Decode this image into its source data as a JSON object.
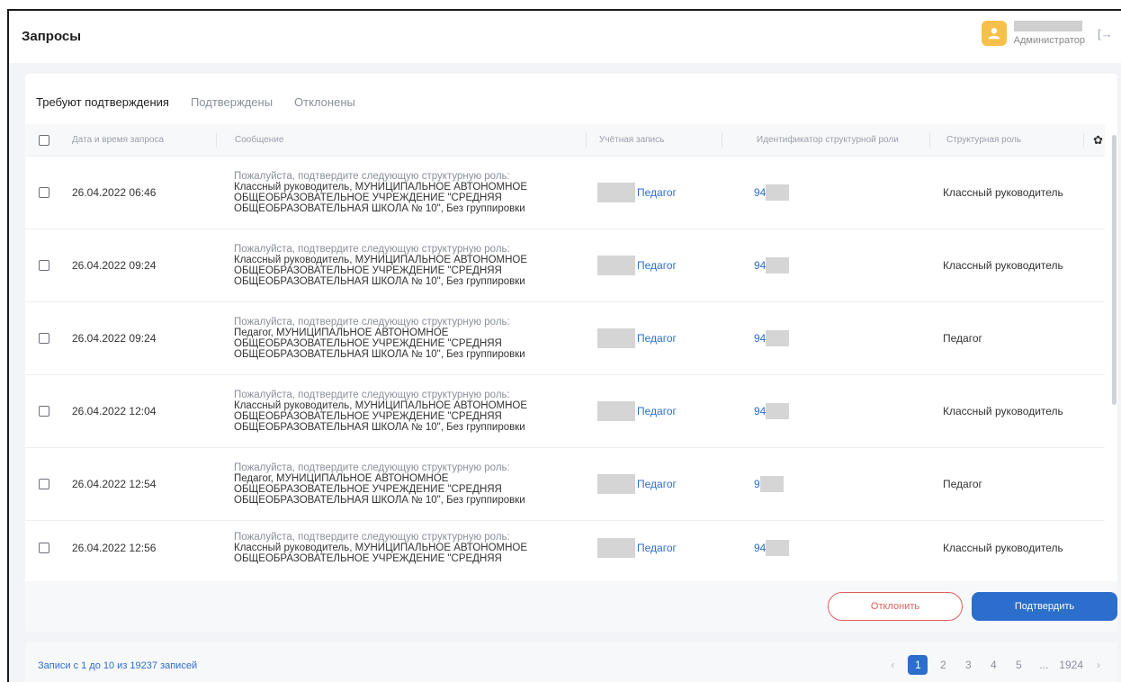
{
  "header": {
    "title": "Запросы",
    "user_role": "Администратор"
  },
  "tabs": [
    {
      "label": "Требуют подтверждения",
      "active": true
    },
    {
      "label": "Подтверждены",
      "active": false
    },
    {
      "label": "Отклонены",
      "active": false
    }
  ],
  "table": {
    "columns": {
      "date": "Дата и время запроса",
      "message": "Сообщение",
      "account": "Учётная запись",
      "role_id": "Идентификатор структурной роли",
      "role": "Структурная роль"
    },
    "rows": [
      {
        "date": "26.04.2022 06:46",
        "msg_top": "Пожалуйста, подтвердите следующую структурную роль:",
        "msg_body": "Классный руководитель, МУНИЦИПАЛЬНОЕ АВТОНОМНОЕ ОБЩЕОБРАЗОВАТЕЛЬНОЕ УЧРЕЖДЕНИЕ \"СРЕДНЯЯ ОБЩЕОБРАЗОВАТЕЛЬНАЯ ШКОЛА № 10\", Без группировки",
        "account": "Педагог",
        "role_id": "94",
        "role": "Классный руководитель"
      },
      {
        "date": "26.04.2022 09:24",
        "msg_top": "Пожалуйста, подтвердите следующую структурную роль:",
        "msg_body": "Классный руководитель, МУНИЦИПАЛЬНОЕ АВТОНОМНОЕ ОБЩЕОБРАЗОВАТЕЛЬНОЕ УЧРЕЖДЕНИЕ \"СРЕДНЯЯ ОБЩЕОБРАЗОВАТЕЛЬНАЯ ШКОЛА № 10\", Без группировки",
        "account": "Педагог",
        "role_id": "94",
        "role": "Классный руководитель"
      },
      {
        "date": "26.04.2022 09:24",
        "msg_top": "Пожалуйста, подтвердите следующую структурную роль:",
        "msg_body": "Педагог, МУНИЦИПАЛЬНОЕ АВТОНОМНОЕ ОБЩЕОБРАЗОВАТЕЛЬНОЕ УЧРЕЖДЕНИЕ \"СРЕДНЯЯ ОБЩЕОБРАЗОВАТЕЛЬНАЯ ШКОЛА № 10\", Без группировки",
        "account": "Педагог",
        "role_id": "94",
        "role": "Педагог"
      },
      {
        "date": "26.04.2022 12:04",
        "msg_top": "Пожалуйста, подтвердите следующую структурную роль:",
        "msg_body": "Классный руководитель, МУНИЦИПАЛЬНОЕ АВТОНОМНОЕ ОБЩЕОБРАЗОВАТЕЛЬНОЕ УЧРЕЖДЕНИЕ \"СРЕДНЯЯ ОБЩЕОБРАЗОВАТЕЛЬНАЯ ШКОЛА № 10\", Без группировки",
        "account": "Педагог",
        "role_id": "94",
        "role": "Классный руководитель"
      },
      {
        "date": "26.04.2022 12:54",
        "msg_top": "Пожалуйста, подтвердите следующую структурную роль:",
        "msg_body": "Педагог, МУНИЦИПАЛЬНОЕ АВТОНОМНОЕ ОБЩЕОБРАЗОВАТЕЛЬНОЕ УЧРЕЖДЕНИЕ \"СРЕДНЯЯ ОБЩЕОБРАЗОВАТЕЛЬНАЯ ШКОЛА № 10\", Без группировки",
        "account": "Педагог",
        "role_id": "9",
        "role": "Педагог"
      },
      {
        "date": "26.04.2022 12:56",
        "msg_top": "Пожалуйста, подтвердите следующую структурную роль:",
        "msg_body": "Классный руководитель, МУНИЦИПАЛЬНОЕ АВТОНОМНОЕ ОБЩЕОБРАЗОВАТЕЛЬНОЕ УЧРЕЖДЕНИЕ \"СРЕДНЯЯ",
        "account": "Педагог",
        "role_id": "94",
        "role": "Классный руководитель"
      }
    ]
  },
  "actions": {
    "reject_label": "Отклонить",
    "confirm_label": "Подтвердить"
  },
  "footer": {
    "records_text": "Записи с 1 до 10 из 19237 записей",
    "pages": [
      "1",
      "2",
      "3",
      "4",
      "5",
      "...",
      "1924"
    ],
    "prev": "‹",
    "next": "›"
  },
  "colors": {
    "accent": "#2c6ecb",
    "reject": "#e35d5d",
    "avatar": "#f7c04a"
  },
  "icons": {
    "logout": "logout-icon",
    "settings": "gear-icon",
    "avatar": "user-icon"
  }
}
